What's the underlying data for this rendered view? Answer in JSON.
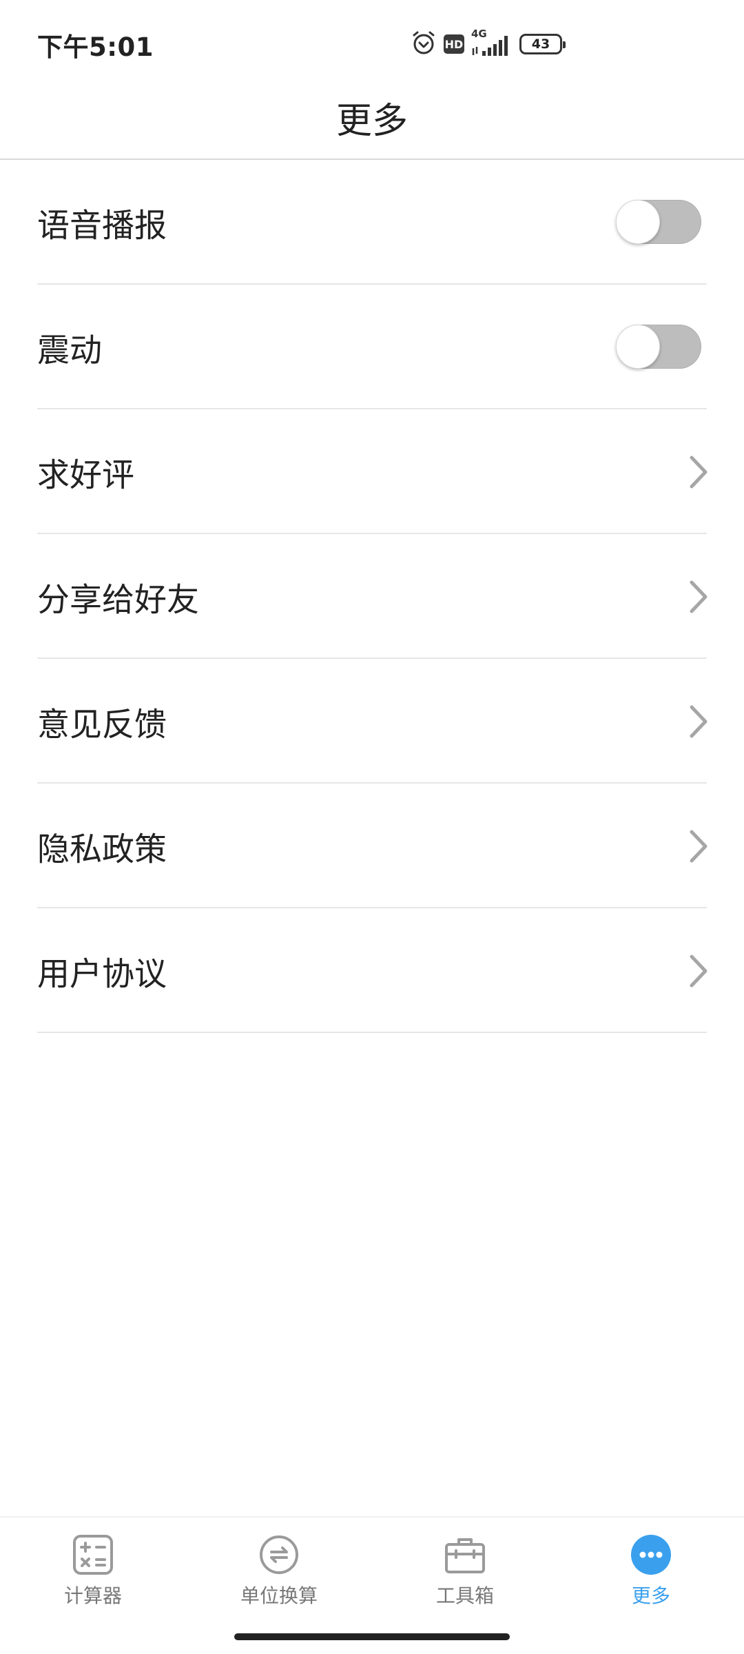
{
  "status_bar": {
    "time": "下午5:01",
    "icons": [
      "alarm-icon",
      "hd-badge",
      "4g-signal-icon",
      "battery-icon"
    ],
    "hd_label": "HD",
    "network_label": "4G",
    "battery_level": "43"
  },
  "header": {
    "title": "更多"
  },
  "settings": {
    "items": [
      {
        "label": "语音播报",
        "control": "toggle",
        "enabled": false
      },
      {
        "label": "震动",
        "control": "toggle",
        "enabled": false
      },
      {
        "label": "求好评",
        "control": "chevron-right-icon"
      },
      {
        "label": "分享给好友",
        "control": "chevron-right-icon"
      },
      {
        "label": "意见反馈",
        "control": "chevron-right-icon"
      },
      {
        "label": "隐私政策",
        "control": "chevron-right-icon"
      },
      {
        "label": "用户协议",
        "control": "chevron-right-icon"
      }
    ]
  },
  "bottom_nav": {
    "items": [
      {
        "label": "计算器",
        "icon": "calculator-icon",
        "active": false
      },
      {
        "label": "单位换算",
        "icon": "unit-convert-icon",
        "active": false
      },
      {
        "label": "工具箱",
        "icon": "toolbox-icon",
        "active": false
      },
      {
        "label": "更多",
        "icon": "more-dots-icon",
        "active": true
      }
    ]
  },
  "colors": {
    "accent": "#3aa0ee",
    "toggle_off": "#bdbdbd",
    "divider": "#e6e6e6",
    "text_primary": "#222222",
    "nav_inactive": "#777777"
  }
}
